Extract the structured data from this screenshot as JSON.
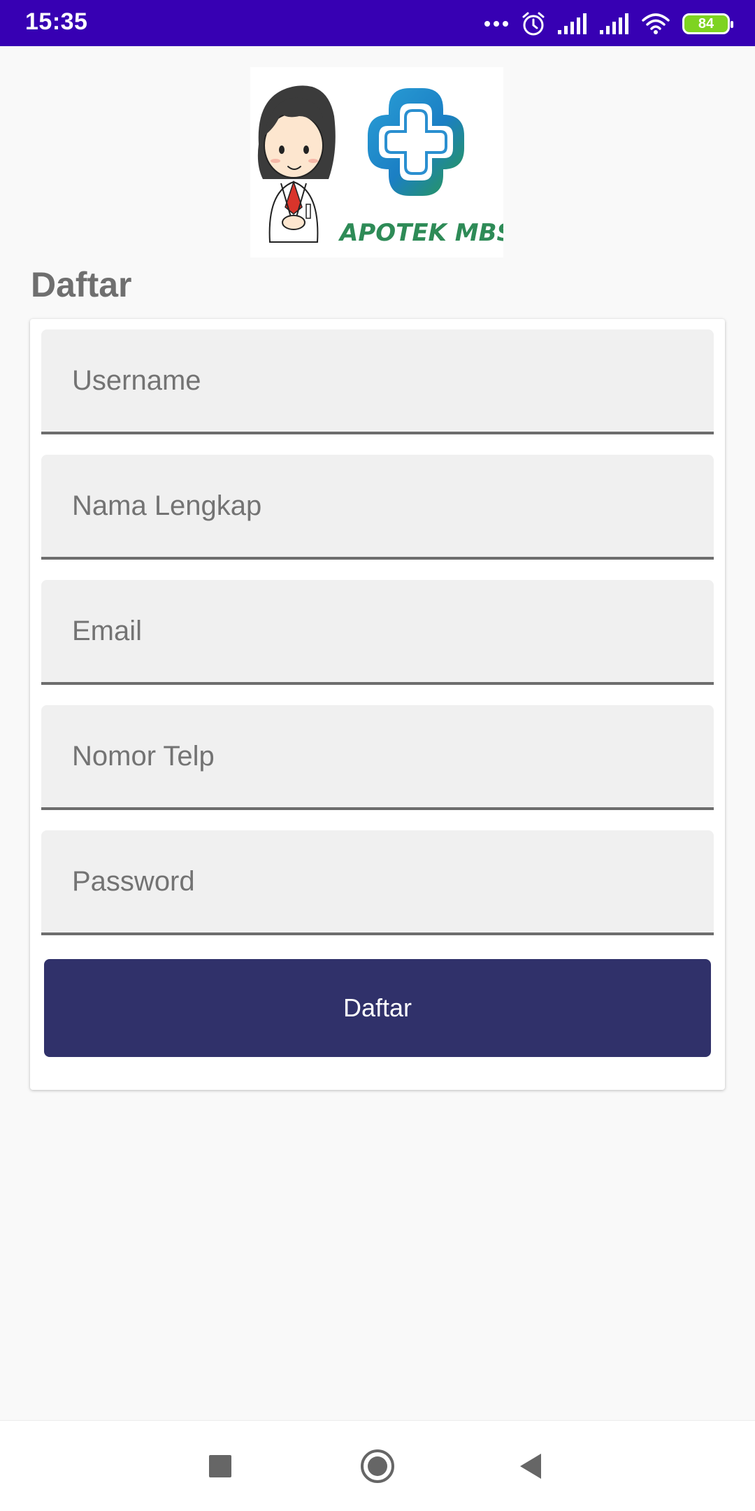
{
  "status_bar": {
    "time": "15:35",
    "battery_level": "84",
    "icons": [
      "more-dots-icon",
      "alarm-icon",
      "signal-icon",
      "signal-icon",
      "wifi-icon",
      "battery-icon"
    ]
  },
  "logo": {
    "brand_text": "APOTEK MBS",
    "icon": "pharmacy-cross-logo"
  },
  "page": {
    "title": "Daftar"
  },
  "form": {
    "fields": [
      {
        "placeholder": "Username",
        "value": ""
      },
      {
        "placeholder": "Nama Lengkap",
        "value": ""
      },
      {
        "placeholder": "Email",
        "value": ""
      },
      {
        "placeholder": "Nomor Telp",
        "value": ""
      },
      {
        "placeholder": "Password",
        "value": ""
      }
    ],
    "submit_label": "Daftar"
  },
  "nav_bar": {
    "buttons": [
      "recents-square-icon",
      "home-circle-icon",
      "back-triangle-icon"
    ]
  },
  "colors": {
    "status_bar": "#3700b3",
    "button": "#30316a",
    "title": "#6f6f6f",
    "background": "#f9f9f9"
  }
}
